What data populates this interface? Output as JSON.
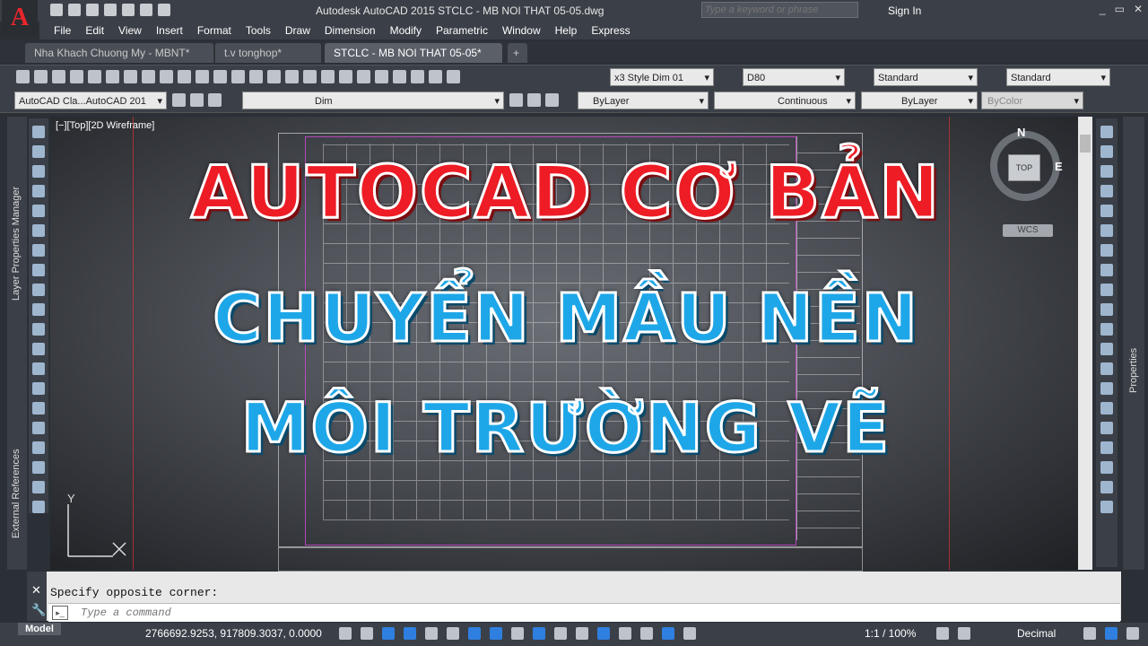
{
  "window": {
    "title": "Autodesk AutoCAD 2015    STCLC - MB NOI THAT 05-05.dwg",
    "search_placeholder": "Type a keyword or phrase",
    "signin_label": "Sign In",
    "app_logo_letter": "A"
  },
  "menu": [
    "File",
    "Edit",
    "View",
    "Insert",
    "Format",
    "Tools",
    "Draw",
    "Dimension",
    "Modify",
    "Parametric",
    "Window",
    "Help",
    "Express"
  ],
  "tabs": [
    {
      "label": "Nha Khach Chuong My - MBNT*",
      "active": false
    },
    {
      "label": "t.v tonghop*",
      "active": false
    },
    {
      "label": "STCLC - MB NOI THAT 05-05*",
      "active": true
    }
  ],
  "toolbar": {
    "dim_style": "x3 Style Dim 01",
    "dim_value": "D80",
    "text_style": "Standard",
    "table_style": "Standard",
    "workspace": "AutoCAD Cla...AutoCAD 201",
    "layer": "Dim",
    "color": "ByLayer",
    "linetype": "Continuous",
    "lineweight": "ByLayer",
    "plotstyle": "ByColor"
  },
  "panels": {
    "left_label_1": "Layer Properties Manager",
    "left_label_2": "External References",
    "right_label": "Properties"
  },
  "viewport": {
    "label": "[−][Top][2D Wireframe]",
    "viewcube_top": "TOP",
    "viewcube_n": "N",
    "viewcube_e": "E",
    "wcs_label": "WCS",
    "ucs_y": "Y"
  },
  "overlay": {
    "line1": "AUTOCAD CƠ BẢN",
    "line2": "CHUYỂN MẦU NỀN",
    "line3": "MÔI TRƯỜNG VẼ",
    "color_red": "#ee1c25",
    "color_blue": "#1ea7e8"
  },
  "command": {
    "history": "Specify opposite corner:",
    "placeholder": "Type a command"
  },
  "status": {
    "model_tab": "Model",
    "coordinates": "2766692.9253, 917809.3037, 0.0000",
    "scale": "1:1 / 100%",
    "units": "Decimal"
  }
}
